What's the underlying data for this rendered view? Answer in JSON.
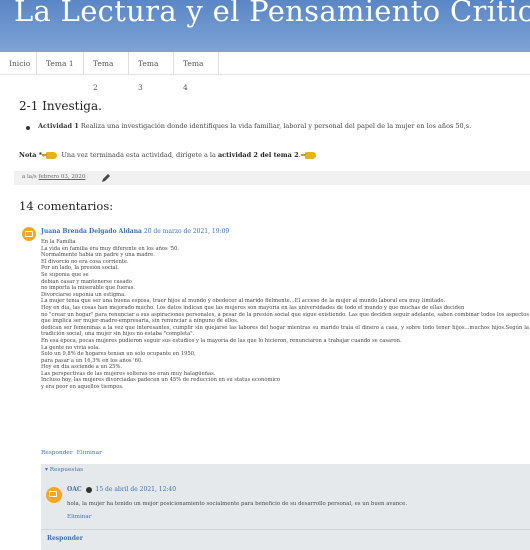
{
  "blog": {
    "title": "La Lectura y el Pensamiento Crítico."
  },
  "nav": {
    "tabs": [
      "Inicio",
      "Tema 1",
      "Tema 2",
      "Tema 3",
      "Tema 4"
    ]
  },
  "post": {
    "title": "2-1 Investiga.",
    "activity_label": "Actividad 1",
    "activity_text": " Realiza una investigación donde identifiques la vida familiar, laboral y personal del papel de la mujer en los años 50,s.",
    "note_label": "Nota *",
    "note_text_1": ":",
    "note_text_2": " Una vez terminada esta actividad, dirígete a  la ",
    "note_bold": "actividad 2 del tema 2",
    "note_end": ".",
    "date_prefix": "a la/s ",
    "date_link": "febrero 03, 2020"
  },
  "comments": {
    "heading": "14 comentarios:",
    "items": [
      {
        "author": "Juana Brenda Delgado Aldana",
        "date": "20 de marzo de 2021, 19:09",
        "lines": [
          "En la Familia",
          "La vida en familia era muy diferente en los años '50.",
          "Normalmente había un padre y una madre.",
          "El divorcio no era cosa corriente.",
          "Por un lado, la presión social.",
          "Se suponía que se",
          "debían casar y mantenerse casado",
          "no importa la miserable que fueras.",
          "Divorciarse suponía un estigma.",
          "La mujer tenía que ser una buena esposa, traer hijos al mundo y obedecer al marido fielmente...El acceso de la mujer al mundo laboral era muy limitado.",
          "Hoy en día, las cosas han mejorado mucho. Los datos indican que las mujeres son mayoría en las universidades de todo el mundo y que muchas de ellas deciden",
          "no \"crear un hogar\" para renunciar a sus aspiraciones personales, a pesar de la presión social que sigue existiendo. Las que deciden seguir adelante, saben combinar todos los aspectos que implica ser mujer-madre-empresaria, sin renunciar a ninguno de ellos.",
          "dedican ser femeninas a la vez que interesantes, cumplir sin quejarse las labores del hogar mientras su marido traía el dinero a casa, y sobre todo tener hijos...muchos hijos.Según la tradición social, una mujer sin hijos no estaba \"completa\".",
          "En esa época, pocas mujeres pudieron seguir sus estudios y la mayoría de las que lo hicieron, renunciaron a trabajar cuando se casaron.",
          "La gente no vivía sola.",
          "Solo un 9,8% de hogares tenían un solo ocupante en 1950,",
          "para pasar a un 16,3% en los años '60.",
          "Hoy en día asciende a un 25%.",
          "Las perspectivas de las mujeres solteras no eran muy halagüeñas.",
          "Incluso hoy, las mujeres divorciadas padecen un 45% de reducción en su status económico",
          "y era peor en aquellos tiempos."
        ],
        "reply_link": "Responder",
        "delete_link": "Eliminar"
      }
    ],
    "replies_toggle": "▾ Respuestas",
    "reply": {
      "author": "OAC",
      "date": "15 de abril de 2021, 12:40",
      "text": "hola, la mujer ha tenido un mejor posicionamiento socialmente para beneficio de su desarrollo personal, es un buen avance.",
      "delete_link": "Eliminar"
    },
    "respond_button": "Responder"
  },
  "colors": {
    "header": "#6b93cc",
    "link": "#3d6fb6",
    "avatar": "#f5a623",
    "replies_bg": "#e5e9ec"
  },
  "icons": [
    "hand-pointer-icon",
    "pencil-icon",
    "blogger-avatar-icon",
    "verified-icon"
  ]
}
